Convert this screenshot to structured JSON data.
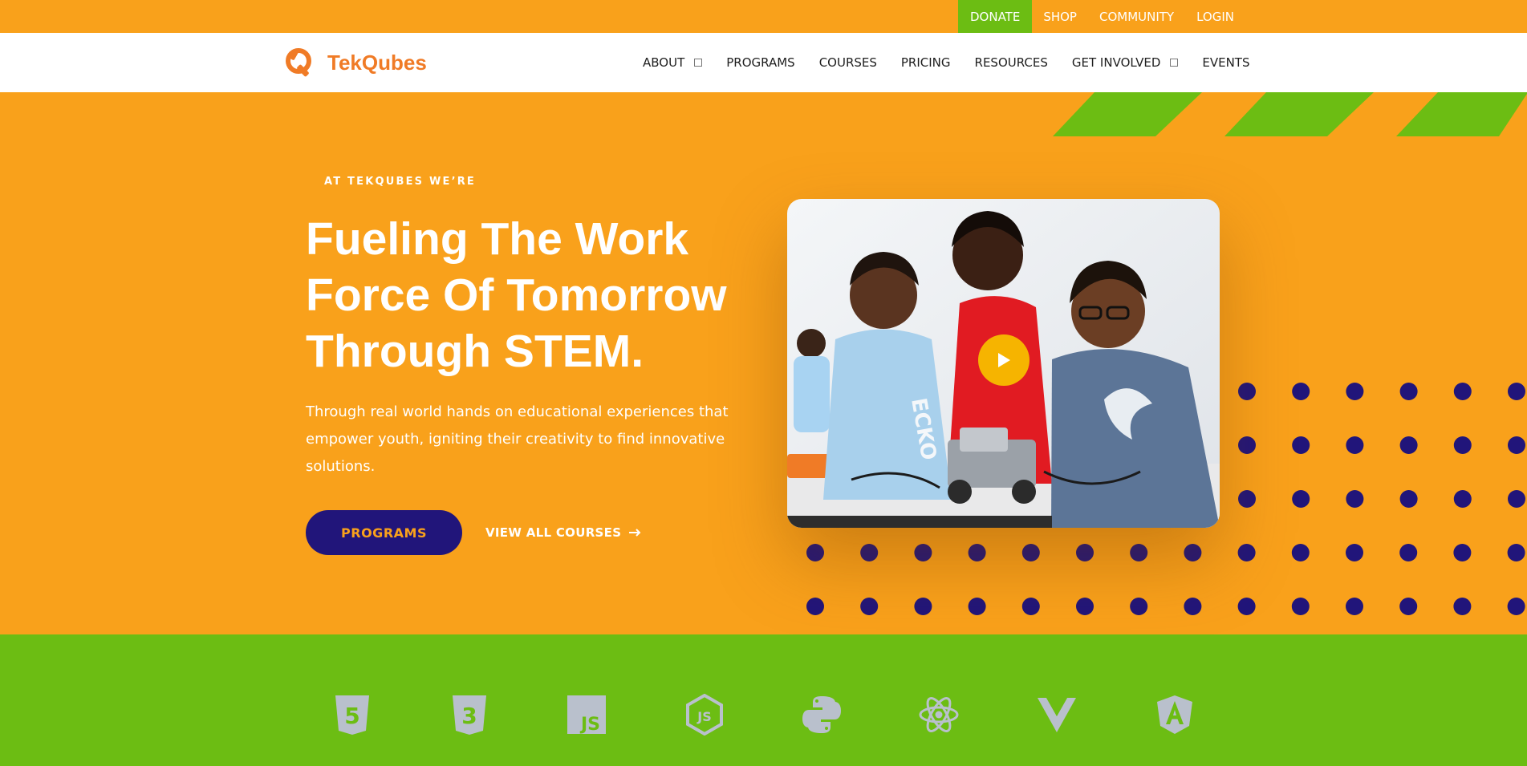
{
  "topbar": {
    "links": [
      "DONATE",
      "SHOP",
      "COMMUNITY",
      "LOGIN"
    ]
  },
  "header": {
    "logo_text": "TekQubes",
    "nav": [
      "ABOUT",
      "PROGRAMS",
      "COURSES",
      "PRICING",
      "RESOURCES",
      "GET INVOLVED",
      "EVENTS"
    ]
  },
  "hero": {
    "eyebrow": "AT TEKQUBES WE’RE",
    "headline": "Fueling The Work Force Of Tomorrow Through STEM.",
    "subtext": "Through real world hands on educational experiences that empower youth, igniting their creativity to find innovative solutions.",
    "primary_button": "PROGRAMS",
    "secondary_link": "VIEW ALL COURSES",
    "video_icon": "play-icon"
  },
  "tech_icons": [
    "html5-icon",
    "css3-icon",
    "javascript-icon",
    "nodejs-icon",
    "python-icon",
    "react-icon",
    "vue-icon",
    "angular-icon"
  ],
  "colors": {
    "orange": "#f9a11b",
    "green": "#6cbd13",
    "navy": "#21157a",
    "brand_orange": "#f07b26",
    "play_yellow": "#f6b400",
    "icon_gray": "#b9c0cc"
  }
}
